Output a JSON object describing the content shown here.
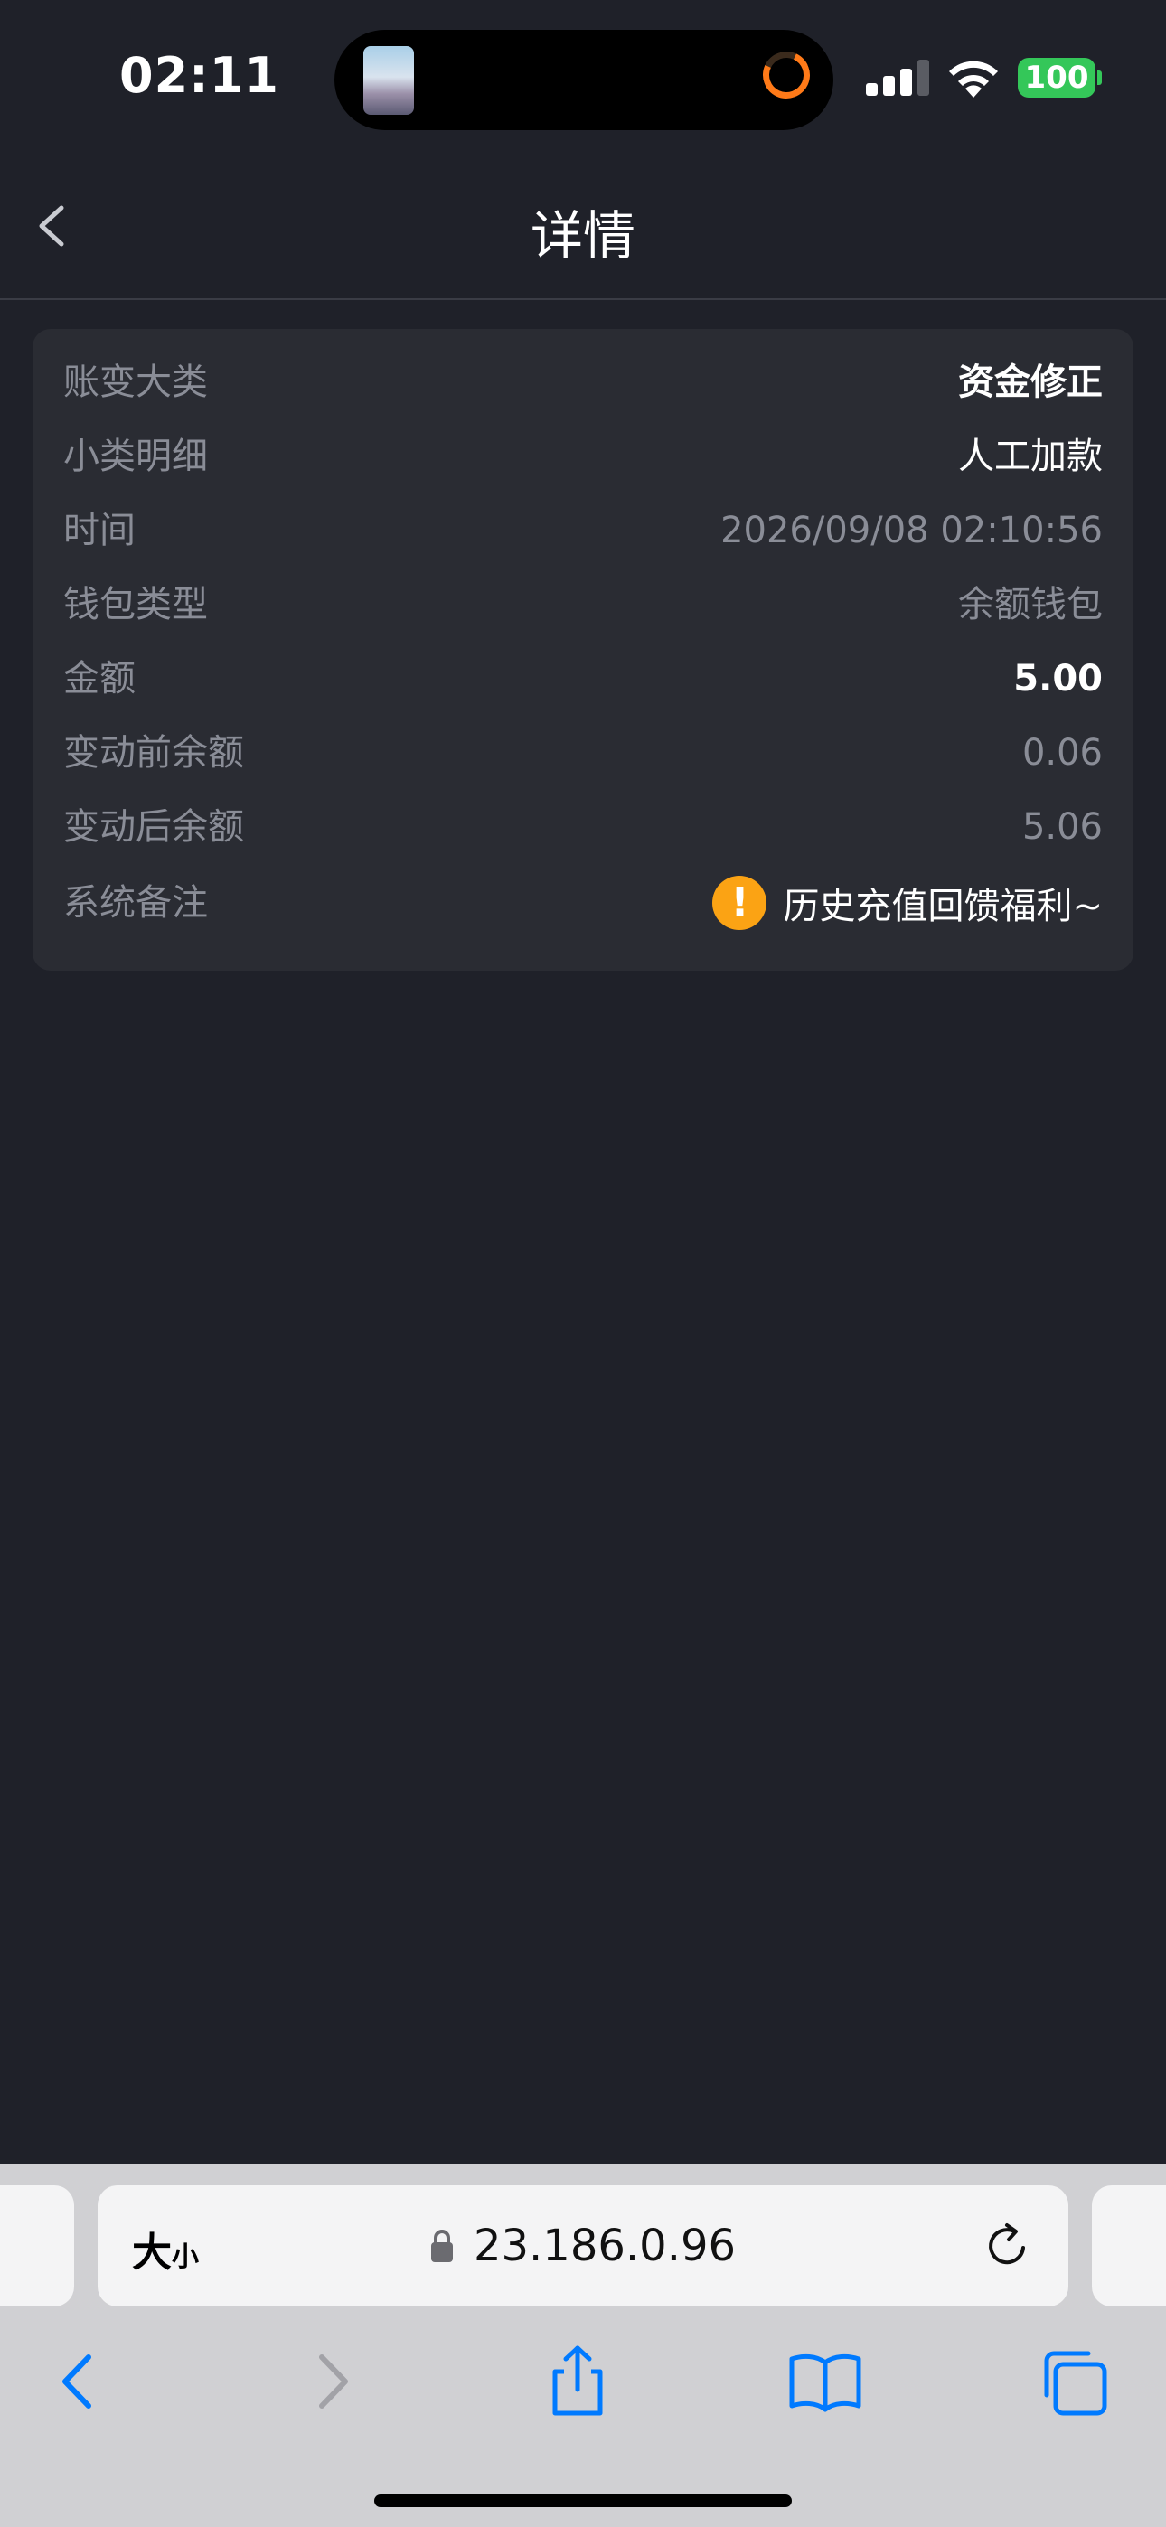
{
  "status_bar": {
    "time": "02:11",
    "battery": "100",
    "icons": [
      "cellular-signal-icon",
      "wifi-icon",
      "battery-icon"
    ]
  },
  "nav": {
    "title": "详情",
    "back_icon": "chevron-left-icon"
  },
  "details": {
    "rows": [
      {
        "label": "账变大类",
        "value": "资金修正"
      },
      {
        "label": "小类明细",
        "value": "人工加款"
      },
      {
        "label": "时间",
        "value": "2026/09/08 02:10:56"
      },
      {
        "label": "钱包类型",
        "value": "余额钱包"
      },
      {
        "label": "金额",
        "value": "5.00"
      },
      {
        "label": "变动前余额",
        "value": "0.06"
      },
      {
        "label": "变动后余额",
        "value": "5.06"
      },
      {
        "label": "系统备注",
        "value": "历史充值回馈福利~",
        "icon": "warning-icon",
        "icon_glyph": "!"
      }
    ]
  },
  "browser": {
    "reader_big": "大",
    "reader_small": "小",
    "url": "23.186.0.96",
    "toolbar_icons": [
      "back-icon",
      "forward-icon",
      "share-icon",
      "bookmarks-icon",
      "tabs-icon"
    ]
  },
  "colors": {
    "background": "#1f2129",
    "card": "#2a2c33",
    "label": "#8a8d97",
    "warning": "#fba314",
    "accent": "#007aff",
    "battery": "#34c759"
  }
}
